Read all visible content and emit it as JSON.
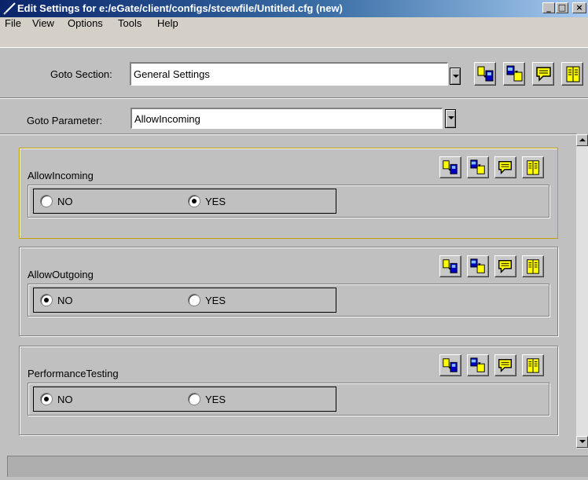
{
  "window": {
    "title": "Edit Settings for e:/eGate/client/configs/stcewfile/Untitled.cfg (new)",
    "controls": {
      "minimize": "_",
      "maximize": "□",
      "close": "×"
    }
  },
  "menu": [
    "File",
    "View",
    "Options",
    "Tools",
    "Help"
  ],
  "goto_section": {
    "label": "Goto Section:",
    "value": "General Settings"
  },
  "goto_parameter": {
    "label": "Goto Parameter:",
    "value": "AllowIncoming"
  },
  "toolbar_icons": [
    "copy-to-device-icon",
    "paste-icon",
    "comment-icon",
    "book-icon"
  ],
  "parameters": [
    {
      "name": "AllowIncoming",
      "options": [
        "NO",
        "YES"
      ],
      "selected": "YES"
    },
    {
      "name": "AllowOutgoing",
      "options": [
        "NO",
        "YES"
      ],
      "selected": "NO"
    },
    {
      "name": "PerformanceTesting",
      "options": [
        "NO",
        "YES"
      ],
      "selected": "NO"
    }
  ],
  "colors": {
    "title_gradient_start": "#0a246a",
    "title_gradient_end": "#a6caf0",
    "icon_yellow": "#ffff00",
    "icon_blue": "#0000c0",
    "focus_border": "#c0a000"
  }
}
